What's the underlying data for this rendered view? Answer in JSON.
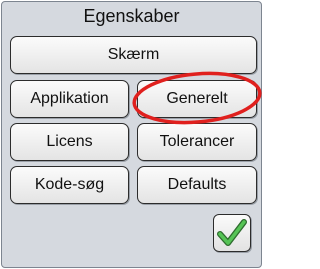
{
  "window": {
    "title": "Egenskaber"
  },
  "buttons": {
    "screen": "Skærm",
    "application": "Applikation",
    "general": "Generelt",
    "license": "Licens",
    "tolerances": "Tolerancer",
    "code_search": "Kode-søg",
    "defaults": "Defaults"
  },
  "confirm": {
    "icon": "checkmark-icon",
    "color": "#3a9b3a"
  },
  "annotation": {
    "highlight_color": "#e0201e",
    "highlighted_item": "Generelt"
  }
}
